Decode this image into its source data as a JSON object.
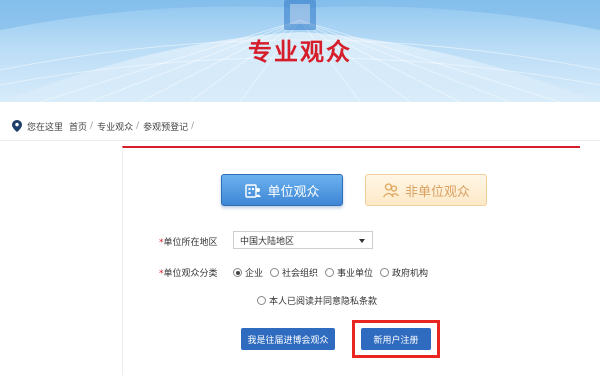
{
  "banner": {
    "title": "专业观众"
  },
  "breadcrumb": {
    "lead": "您在这里",
    "items": [
      "首页",
      "专业观众",
      "参观预登记"
    ],
    "separator": "/"
  },
  "audience_types": {
    "unit": "单位观众",
    "non_unit": "非单位观众",
    "selected": "单位观众"
  },
  "form": {
    "region": {
      "label": "单位所在地区",
      "value": "中国大陆地区"
    },
    "category": {
      "label": "单位观众分类",
      "options": [
        "企业",
        "社会组织",
        "事业单位",
        "政府机构"
      ],
      "selected": "企业"
    },
    "privacy": {
      "label": "本人已阅读并同意隐私条款",
      "checked": false
    },
    "required_mark": "*"
  },
  "buttons": {
    "past_visitor": "我是往届进博会观众",
    "new_user": "新用户注册"
  },
  "colors": {
    "brand_red": "#d61e2a",
    "primary_blue": "#2f6cc0",
    "highlight_frame": "#e8261f",
    "inactive_orange": "#d9a163"
  }
}
